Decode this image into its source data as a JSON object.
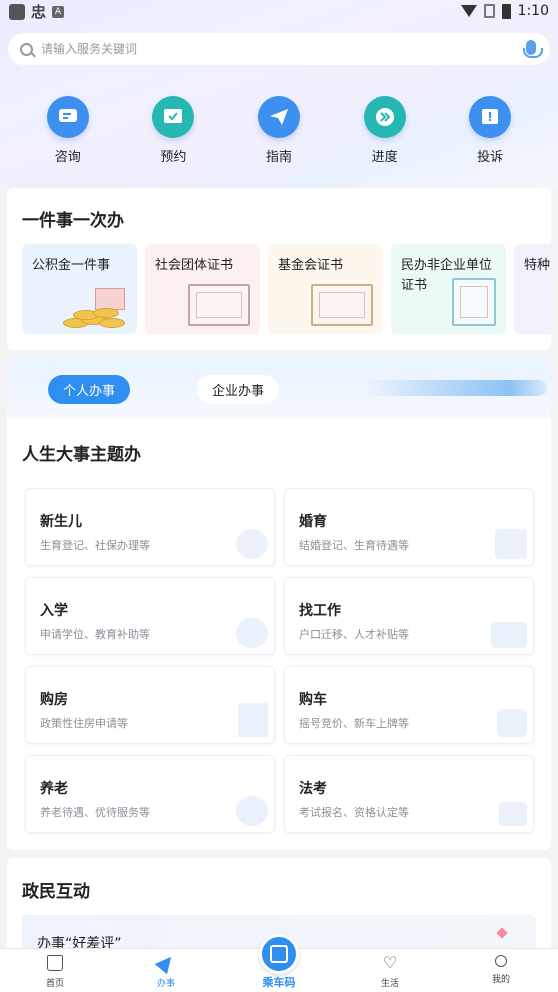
{
  "status_bar": {
    "left_glyph": "忠",
    "left_badge": "A",
    "time": "1:10"
  },
  "search": {
    "placeholder": "请输入服务关键词",
    "icon": "search-icon",
    "voice_icon": "microphone-icon"
  },
  "quick_actions": [
    {
      "label": "咨询",
      "icon": "chat-icon",
      "color": "#3d8ff0"
    },
    {
      "label": "预约",
      "icon": "calendar-check-icon",
      "color": "#27b7b2"
    },
    {
      "label": "指南",
      "icon": "paper-plane-icon",
      "color": "#3d8ff0"
    },
    {
      "label": "进度",
      "icon": "fast-forward-icon",
      "color": "#27b7b2"
    },
    {
      "label": "投诉",
      "icon": "alert-icon",
      "color": "#3d8ff0"
    }
  ],
  "one_item": {
    "title": "一件事一次办",
    "tiles": [
      {
        "label": "公积金一件事",
        "bg": "#eaf3fd"
      },
      {
        "label": "社会团体证书",
        "bg": "#fdf0f0"
      },
      {
        "label": "基金会证书",
        "bg": "#fdf7ee"
      },
      {
        "label": "民办非企业单位证书",
        "bg": "#ebf9f7"
      },
      {
        "label": "特种",
        "bg": "#f3f0fb"
      }
    ]
  },
  "tabs": {
    "personal": "个人办事",
    "enterprise": "企业办事"
  },
  "life_events": {
    "title": "人生大事主题办",
    "items": [
      {
        "name": "新生儿",
        "desc": "生育登记、社保办理等"
      },
      {
        "name": "婚育",
        "desc": "结婚登记、生育待遇等"
      },
      {
        "name": "入学",
        "desc": "申请学位、教育补助等"
      },
      {
        "name": "找工作",
        "desc": "户口迁移、人才补贴等"
      },
      {
        "name": "购房",
        "desc": "政策性住房申请等"
      },
      {
        "name": "购车",
        "desc": "摇号竞价、新车上牌等"
      },
      {
        "name": "养老",
        "desc": "养老待遇、优待服务等"
      },
      {
        "name": "法考",
        "desc": "考试报名、资格认定等"
      }
    ]
  },
  "gov_interaction": {
    "title": "政民互动",
    "item": "办事“好差评”"
  },
  "bottom_nav": {
    "home": "首页",
    "service": "办事",
    "bus_code": "乘车码",
    "life": "生活",
    "mine": "我的"
  },
  "colors": {
    "accent": "#2f8ff0",
    "teal": "#27b7b2"
  }
}
